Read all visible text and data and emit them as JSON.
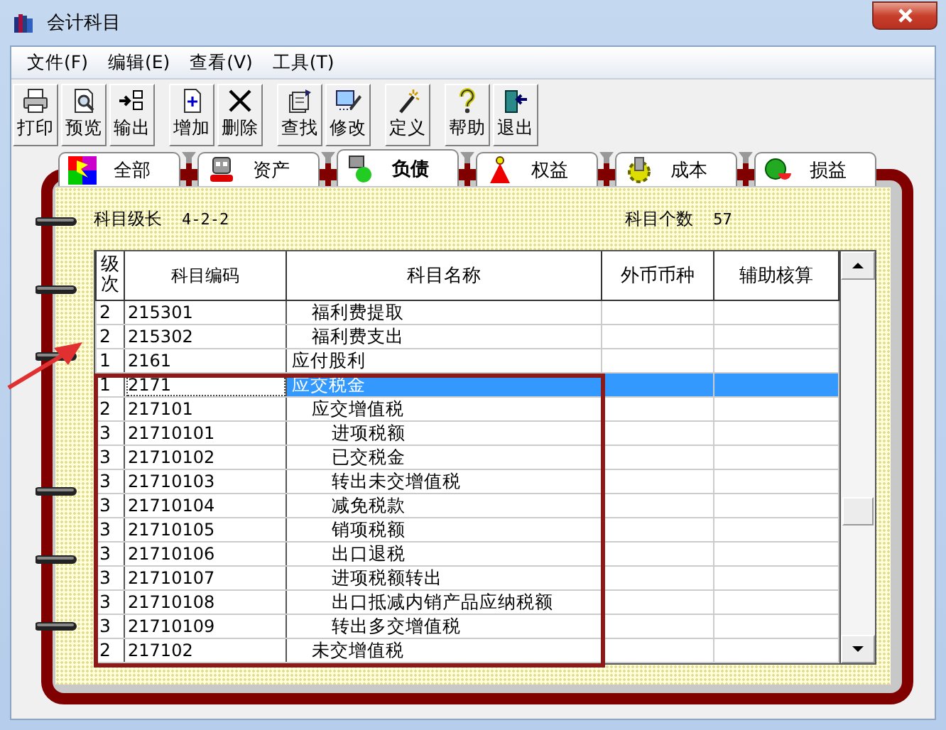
{
  "window": {
    "title": "会计科目"
  },
  "menu": [
    "文件(F)",
    "编辑(E)",
    "查看(V)",
    "工具(T)"
  ],
  "toolbar": [
    [
      "打印",
      "预览",
      "输出"
    ],
    [
      "增加",
      "删除"
    ],
    [
      "查找",
      "修改"
    ],
    [
      "定义"
    ],
    [
      "帮助",
      "退出"
    ]
  ],
  "tabs": [
    {
      "label": "全部",
      "selected": false
    },
    {
      "label": "资产",
      "selected": false
    },
    {
      "label": "负债",
      "selected": true
    },
    {
      "label": "权益",
      "selected": false
    },
    {
      "label": "成本",
      "selected": false
    },
    {
      "label": "损益",
      "selected": false
    }
  ],
  "info": {
    "level_label": "科目级长",
    "level_value": "4-2-2",
    "count_label": "科目个数",
    "count_value": "57"
  },
  "table": {
    "columns": [
      "级次",
      "科目编码",
      "科目名称",
      "外币币种",
      "辅助核算"
    ],
    "rows": [
      {
        "level": "2",
        "code": "215301",
        "name": "福利费提取",
        "selected": false
      },
      {
        "level": "2",
        "code": "215302",
        "name": "福利费支出",
        "selected": false
      },
      {
        "level": "1",
        "code": "2161",
        "name": "应付股利",
        "selected": false
      },
      {
        "level": "1",
        "code": "2171",
        "name": "应交税金",
        "selected": true
      },
      {
        "level": "2",
        "code": "217101",
        "name": "应交增值税",
        "selected": false
      },
      {
        "level": "3",
        "code": "21710101",
        "name": "进项税额",
        "selected": false
      },
      {
        "level": "3",
        "code": "21710102",
        "name": "已交税金",
        "selected": false
      },
      {
        "level": "3",
        "code": "21710103",
        "name": "转出未交增值税",
        "selected": false
      },
      {
        "level": "3",
        "code": "21710104",
        "name": "减免税款",
        "selected": false
      },
      {
        "level": "3",
        "code": "21710105",
        "name": "销项税额",
        "selected": false
      },
      {
        "level": "3",
        "code": "21710106",
        "name": "出口退税",
        "selected": false
      },
      {
        "level": "3",
        "code": "21710107",
        "name": "进项税额转出",
        "selected": false
      },
      {
        "level": "3",
        "code": "21710108",
        "name": "出口抵减内销产品应纳税额",
        "selected": false
      },
      {
        "level": "3",
        "code": "21710109",
        "name": "转出多交增值税",
        "selected": false
      },
      {
        "level": "2",
        "code": "217102",
        "name": "未交增值税",
        "selected": false
      }
    ]
  }
}
